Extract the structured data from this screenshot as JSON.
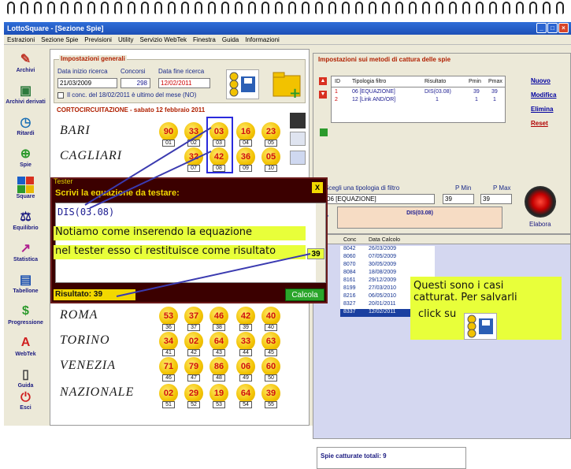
{
  "window": {
    "title": "LottoSquare - [Sezione Spie]"
  },
  "menu": [
    "Estrazioni",
    "Sezione Spie",
    "Previsioni",
    "Utility",
    "Servizio WebTek",
    "Finestra",
    "Guida",
    "Informazioni"
  ],
  "sidebar": [
    "Archivi",
    "Archivi derivati",
    "Ritardi",
    "Spie",
    "Square",
    "Equilibrio",
    "Statistica",
    "Tabellone",
    "Progressione",
    "WebTek",
    "Guida",
    "Esci"
  ],
  "general": {
    "title": "Impostazioni generali",
    "start_label": "Data inizio ricerca",
    "start_value": "21/03/2009",
    "concorsi_label": "Concorsi",
    "concorsi_value": "298",
    "end_label": "Data fine ricerca",
    "end_value": "12/02/2011",
    "checkbox_label": "Il conc. del 18/02/2011 è ultimo del mese (NO)"
  },
  "draw": {
    "title": "CORTOCIRCUITAZIONE - sabato 12 febbraio 2011",
    "wheels": [
      {
        "name": "BARI",
        "nums": [
          "90",
          "33",
          "03",
          "16",
          "23"
        ],
        "subs": [
          "01",
          "02",
          "03",
          "04",
          "05"
        ]
      },
      {
        "name": "CAGLIARI",
        "nums": [
          "",
          "32",
          "42",
          "36",
          "05"
        ],
        "subs": [
          "",
          "07",
          "08",
          "09",
          "10"
        ]
      },
      {
        "name": "ROMA",
        "nums": [
          "53",
          "37",
          "46",
          "42",
          "40"
        ],
        "subs": [
          "36",
          "37",
          "38",
          "39",
          "40"
        ]
      },
      {
        "name": "TORINO",
        "nums": [
          "34",
          "02",
          "64",
          "33",
          "63"
        ],
        "subs": [
          "41",
          "42",
          "43",
          "44",
          "45"
        ]
      },
      {
        "name": "VENEZIA",
        "nums": [
          "71",
          "79",
          "86",
          "06",
          "60"
        ],
        "subs": [
          "46",
          "47",
          "48",
          "49",
          "50"
        ]
      },
      {
        "name": "NAZIONALE",
        "nums": [
          "02",
          "29",
          "19",
          "64",
          "39"
        ],
        "subs": [
          "51",
          "52",
          "53",
          "54",
          "55"
        ]
      }
    ]
  },
  "methods": {
    "title": "Impostazioni sui metodi di cattura delle spie",
    "headers": [
      "ID",
      "Tipologia filtro",
      "Risultato",
      "Pmin",
      "Pmax"
    ],
    "rows": [
      [
        "1",
        "06 [EQUAZIONE]",
        "DIS(03.08)",
        "39",
        "39"
      ],
      [
        "2",
        "12 [Link AND/OR]",
        "1",
        "1",
        "1"
      ]
    ],
    "links": [
      "Nuovo",
      "Modifica",
      "Elimina",
      "Reset"
    ],
    "filter_label": "Scegli una tipologia di filtro",
    "filter_value": "06 [EQUAZIONE]",
    "pmin_label": "P Min",
    "pmin_value": "39",
    "pmax_label": "P Max",
    "pmax_value": "39",
    "formula": "DIS(03.08)",
    "elabora": "Elabora"
  },
  "captured": {
    "headers": [
      "Conc",
      "Data Calcolo"
    ],
    "rows": [
      [
        "8042",
        "26/03/2009"
      ],
      [
        "8060",
        "07/05/2009"
      ],
      [
        "8070",
        "30/05/2009"
      ],
      [
        "8084",
        "18/08/2009"
      ],
      [
        "8161",
        "29/12/2009"
      ],
      [
        "8199",
        "27/03/2010"
      ],
      [
        "8216",
        "06/05/2010"
      ],
      [
        "8327",
        "20/01/2011"
      ],
      [
        "8337",
        "12/02/2011"
      ]
    ],
    "total": "Spie catturate totali: 9"
  },
  "tester": {
    "title": "Tester",
    "prompt": "Scrivi la equazione da testare:",
    "equation": "DIS(03.08)",
    "result": "Risultato: 39",
    "badge": "39",
    "calc_button": "Calcola",
    "close": "X"
  },
  "callouts": {
    "left_line1": "Notiamo come inserendo la equazione",
    "left_line2": "nel tester esso ci restituisce come risultato",
    "right_line1": "Questi sono i casi",
    "right_line2": "catturat. Per salvarli",
    "right_line3": "click su"
  }
}
